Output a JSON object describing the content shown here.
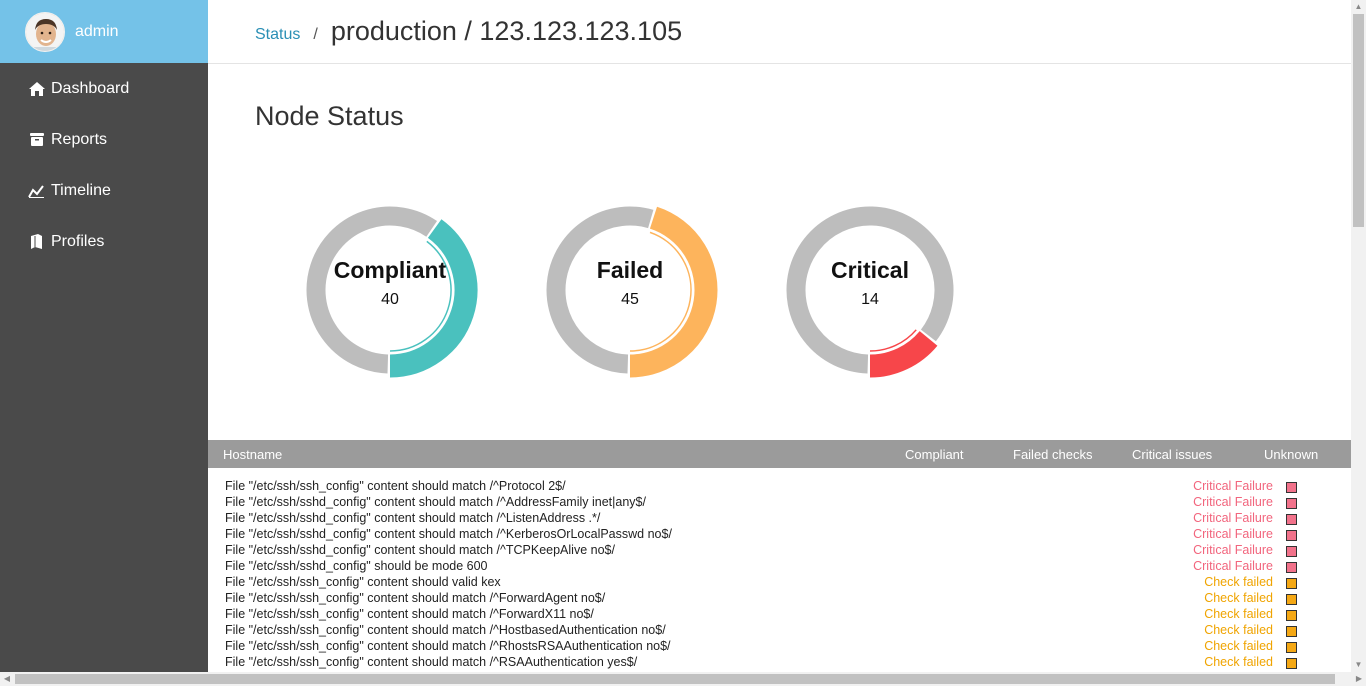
{
  "user": {
    "name": "admin"
  },
  "nav": [
    {
      "label": "Dashboard",
      "icon": "home-icon"
    },
    {
      "label": "Reports",
      "icon": "inbox-icon"
    },
    {
      "label": "Timeline",
      "icon": "line-chart-icon"
    },
    {
      "label": "Profiles",
      "icon": "book-icon"
    }
  ],
  "breadcrumb": {
    "link": "Status",
    "separator": "/",
    "title": "production / 123.123.123.105"
  },
  "section_title": "Node Status",
  "donuts": [
    {
      "name": "Compliant",
      "value": "40",
      "fraction": 0.4,
      "color": "#4ac1be"
    },
    {
      "name": "Failed",
      "value": "45",
      "fraction": 0.45,
      "color": "#fdb45c"
    },
    {
      "name": "Critical",
      "value": "14",
      "fraction": 0.14,
      "color": "#f7464a"
    }
  ],
  "table": {
    "headers": [
      "Hostname",
      "Compliant",
      "Failed checks",
      "Critical issues",
      "Unknown"
    ],
    "rows": [
      {
        "desc": "File \"/etc/ssh/ssh_config\" content should match /^Protocol 2$/",
        "status": "Critical Failure",
        "kind": "critical"
      },
      {
        "desc": "File \"/etc/ssh/sshd_config\" content should match /^AddressFamily inet|any$/",
        "status": "Critical Failure",
        "kind": "critical"
      },
      {
        "desc": "File \"/etc/ssh/sshd_config\" content should match /^ListenAddress .*/",
        "status": "Critical Failure",
        "kind": "critical"
      },
      {
        "desc": "File \"/etc/ssh/sshd_config\" content should match /^KerberosOrLocalPasswd no$/",
        "status": "Critical Failure",
        "kind": "critical"
      },
      {
        "desc": "File \"/etc/ssh/sshd_config\" content should match /^TCPKeepAlive no$/",
        "status": "Critical Failure",
        "kind": "critical"
      },
      {
        "desc": "File \"/etc/ssh/sshd_config\" should be mode 600",
        "status": "Critical Failure",
        "kind": "critical"
      },
      {
        "desc": "File \"/etc/ssh/ssh_config\" content should valid kex",
        "status": "Check failed",
        "kind": "failed"
      },
      {
        "desc": "File \"/etc/ssh/ssh_config\" content should match /^ForwardAgent no$/",
        "status": "Check failed",
        "kind": "failed"
      },
      {
        "desc": "File \"/etc/ssh/ssh_config\" content should match /^ForwardX11 no$/",
        "status": "Check failed",
        "kind": "failed"
      },
      {
        "desc": "File \"/etc/ssh/ssh_config\" content should match /^HostbasedAuthentication no$/",
        "status": "Check failed",
        "kind": "failed"
      },
      {
        "desc": "File \"/etc/ssh/ssh_config\" content should match /^RhostsRSAAuthentication no$/",
        "status": "Check failed",
        "kind": "failed"
      },
      {
        "desc": "File \"/etc/ssh/ssh_config\" content should match /^RSAAuthentication yes$/",
        "status": "Check failed",
        "kind": "failed"
      }
    ]
  },
  "colors": {
    "sidebar": "#4a4a4a",
    "profile_bar": "#74c2e8",
    "link": "#2a8fb5",
    "critical_text": "#f2657d",
    "critical_swatch": "#f2728b",
    "failed_text": "#f0a400",
    "failed_swatch": "#f5a814",
    "track": "#bdbdbd"
  }
}
